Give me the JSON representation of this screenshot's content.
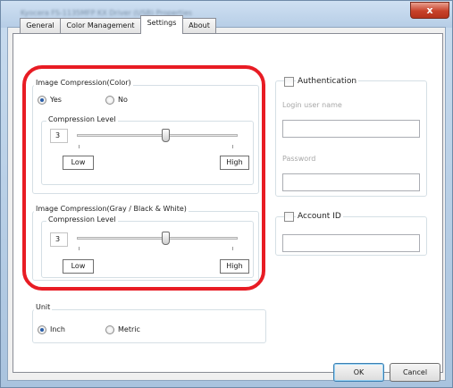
{
  "window": {
    "title": "Kyocera FS-1135MFP KX Driver (USB) Properties",
    "close_glyph": "x"
  },
  "tabs": [
    {
      "label": "General"
    },
    {
      "label": "Color Management"
    },
    {
      "label": "Settings",
      "active": true
    },
    {
      "label": "About"
    }
  ],
  "color_compression": {
    "title": "Image Compression(Color)",
    "yes_label": "Yes",
    "no_label": "No",
    "selected": "Yes",
    "level_label": "Compression Level",
    "value": "3",
    "low_label": "Low",
    "high_label": "High",
    "slider_level": 0.55
  },
  "gray_compression": {
    "title": "Image Compression(Gray / Black & White)",
    "level_label": "Compression Level",
    "value": "3",
    "low_label": "Low",
    "high_label": "High",
    "slider_level": 0.55
  },
  "unit": {
    "title": "Unit",
    "inch_label": "Inch",
    "metric_label": "Metric",
    "selected": "Inch"
  },
  "authentication": {
    "label": "Authentication",
    "checked": false,
    "login_label": "Login user name",
    "login_value": "",
    "password_label": "Password",
    "password_value": ""
  },
  "account": {
    "label": "Account ID",
    "checked": false,
    "value": ""
  },
  "buttons": {
    "ok": "OK",
    "cancel": "Cancel"
  },
  "colors": {
    "highlight": "#e81c24",
    "close_button": "#c7412a",
    "radio_dot": "#2a5ea8"
  }
}
